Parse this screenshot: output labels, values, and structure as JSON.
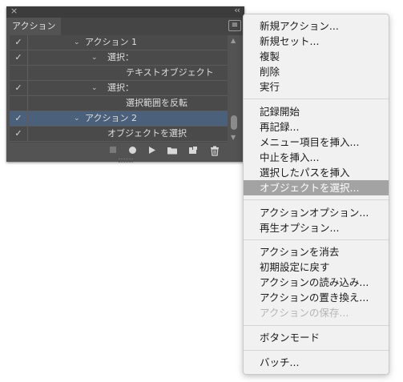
{
  "panel": {
    "close_glyph": "×",
    "collapse_glyph": "‹‹",
    "tab_title": "アクション",
    "menu_button_glyph": "≡",
    "rows": [
      {
        "check": "✓",
        "twisty": "⌄",
        "label": "アクション 1"
      },
      {
        "check": "✓",
        "twisty": "⌄",
        "label": "選択："
      },
      {
        "check": "",
        "twisty": "",
        "label": "テキストオブジェクト"
      },
      {
        "check": "✓",
        "twisty": "⌄",
        "label": "選択："
      },
      {
        "check": "",
        "twisty": "",
        "label": "選択範囲を反転"
      },
      {
        "check": "✓",
        "twisty": "⌄",
        "label": "アクション 2"
      },
      {
        "check": "✓",
        "twisty": "",
        "label": "オブジェクトを選択"
      }
    ],
    "selected_row_color": "#4b607b",
    "toolbar_icons": [
      "stop-icon",
      "record-icon",
      "play-icon",
      "folder-icon",
      "new-action-icon",
      "trash-icon"
    ]
  },
  "menu": {
    "groups": [
      [
        "新規アクション...",
        "新規セット...",
        "複製",
        "削除",
        "実行"
      ],
      [
        "記録開始",
        "再記録...",
        "メニュー項目を挿入...",
        "中止を挿入...",
        "選択したパスを挿入",
        "オブジェクトを選択..."
      ],
      [
        "アクションオプション...",
        "再生オプション..."
      ],
      [
        "アクションを消去",
        "初期設定に戻す",
        "アクションの読み込み...",
        "アクションの置き換え...",
        "アクションの保存..."
      ],
      [
        "ボタンモード"
      ],
      [
        "バッチ..."
      ]
    ],
    "highlighted_item": "オブジェクトを選択...",
    "disabled_items": [
      "アクションの保存..."
    ],
    "highlight_color": "#a3a3a3"
  }
}
